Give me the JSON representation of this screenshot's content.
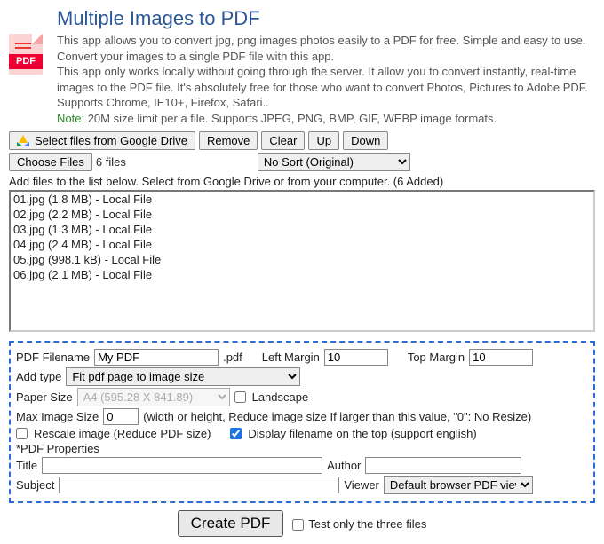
{
  "title": "Multiple Images to PDF",
  "icon_label": "PDF",
  "desc1": "This app allows you to convert jpg, png images photos easily to a PDF for free. Simple and easy to use. Convert your images to a single PDF file with this app.",
  "desc2": "This app only works locally without going through the server. It allow you to convert instantly, real-time images to the PDF file. It's absolutely free for those who want to convert Photos, Pictures to Adobe PDF. Supports Chrome, IE10+, Firefox, Safari..",
  "note_label": "Note:",
  "note_text": "20M size limit per a file. Supports JPEG, PNG, BMP, GIF, WEBP image formats.",
  "toolbar": {
    "gdrive": "Select files from Google Drive",
    "remove": "Remove",
    "clear": "Clear",
    "up": "Up",
    "down": "Down",
    "choose": "Choose Files",
    "count": "6 files",
    "sort": "No Sort (Original)"
  },
  "hint": "Add files to the list below. Select from Google Drive or from your computer. (6 Added)",
  "files": [
    "01.jpg (1.8 MB) - Local File",
    "02.jpg (2.2 MB) - Local File",
    "03.jpg (1.3 MB) - Local File",
    "04.jpg (2.4 MB) - Local File",
    "05.jpg (998.1 kB) - Local File",
    "06.jpg (2.1 MB) - Local File"
  ],
  "opts": {
    "filename_label": "PDF Filename",
    "filename_value": "My PDF",
    "ext": ".pdf",
    "left_margin_label": "Left Margin",
    "left_margin_value": "10",
    "top_margin_label": "Top Margin",
    "top_margin_value": "10",
    "add_type_label": "Add type",
    "add_type_value": "Fit pdf page to image size",
    "paper_size_label": "Paper Size",
    "paper_size_value": "A4 (595.28 X 841.89)",
    "landscape": "Landscape",
    "max_label": "Max Image Size",
    "max_value": "0",
    "max_hint": "(width or height, Reduce image size If larger than this value, \"0\": No Resize)",
    "rescale": "Rescale image (Reduce PDF size)",
    "display_fn": "Display filename on the top (support english)",
    "props_label": "*PDF Properties",
    "title_label": "Title",
    "author_label": "Author",
    "subject_label": "Subject",
    "viewer_label": "Viewer",
    "viewer_value": "Default browser PDF viewer"
  },
  "create_label": "Create PDF",
  "test_label": "Test only the three files"
}
